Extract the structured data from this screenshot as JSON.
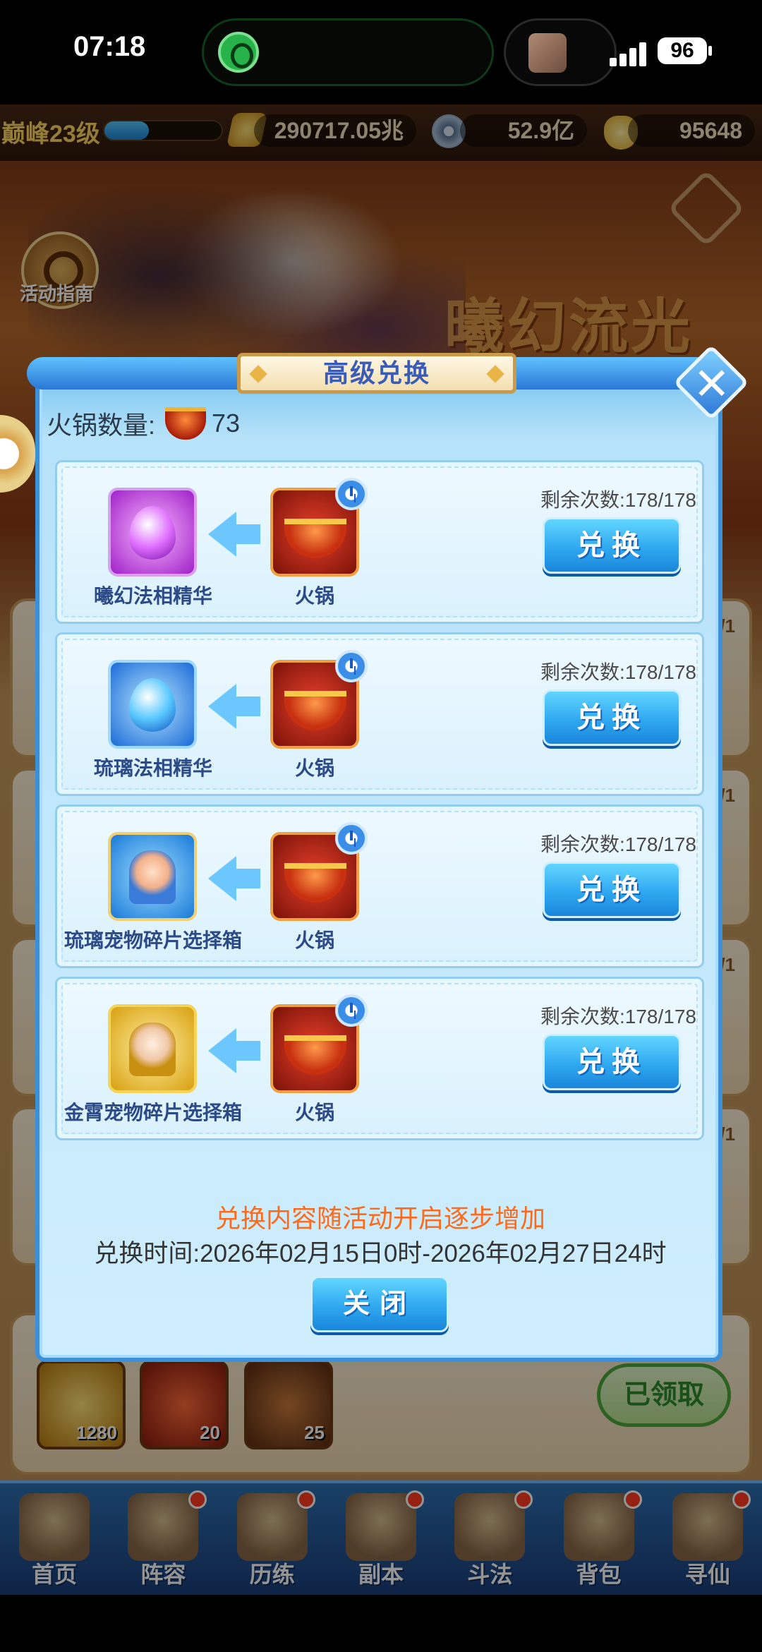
{
  "status_bar": {
    "time": "07:18",
    "battery": "96"
  },
  "resources": {
    "rank": "巅峰23级",
    "exp_progress": 0.38,
    "power": "290717.05兆",
    "coin": "52.9亿",
    "gold": "95648"
  },
  "background": {
    "guide_label": "活动指南",
    "event_title": "曦幻流光",
    "reward_counts": [
      "1280",
      "20",
      "25"
    ],
    "claimed_label": "已领取",
    "badges": [
      "/1",
      "/1",
      "/1",
      "/1"
    ]
  },
  "nav": {
    "items": [
      {
        "label": "首页"
      },
      {
        "label": "阵容"
      },
      {
        "label": "历练"
      },
      {
        "label": "副本"
      },
      {
        "label": "斗法"
      },
      {
        "label": "背包"
      },
      {
        "label": "寻仙"
      }
    ]
  },
  "dialog": {
    "title": "高级兑换",
    "hotpot_label": "火锅数量:",
    "hotpot_count": "73",
    "exchange_button": "兑换",
    "cost_name": "火锅",
    "remain_label": "剩余次数:",
    "rows": [
      {
        "item": "曦幻法相精华",
        "remain": "178/178",
        "icon": "purple-essence-icon"
      },
      {
        "item": "琉璃法相精华",
        "remain": "178/178",
        "icon": "blue-essence-icon"
      },
      {
        "item": "琉璃宠物碎片选择箱",
        "remain": "178/178",
        "icon": "blue-pet-chest-icon"
      },
      {
        "item": "金霄宠物碎片选择箱",
        "remain": "178/178",
        "icon": "gold-pet-chest-icon"
      }
    ],
    "footer_note": "兑换内容随活动开启逐步增加",
    "footer_time": "兑换时间:2026年02月15日0时-2026年02月27日24时",
    "close_button": "关闭"
  }
}
